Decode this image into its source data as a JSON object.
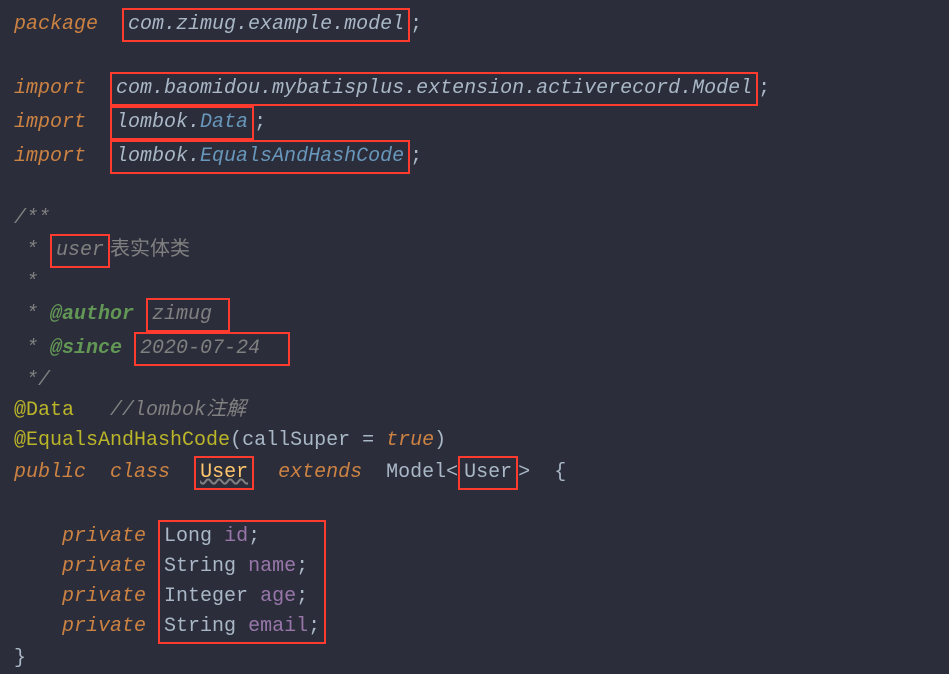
{
  "code": {
    "package_kw": "package",
    "package_name": "com.zimug.example.model",
    "import_kw": "import",
    "import1": "com.baomidou.mybatisplus.extension.activerecord.Model",
    "import2_pre": "lombok.",
    "import2_cls": "Data",
    "import3_pre": "lombok.",
    "import3_cls": "EqualsAndHashCode",
    "doc_start": "/**",
    "doc_user": "user",
    "doc_user_suffix": "表实体类",
    "doc_star": " *",
    "doc_author_tag": "@author",
    "doc_author_val": "zimug ",
    "doc_since_tag": "@since",
    "doc_since_val": "2020-07-24  ",
    "doc_end": " */",
    "anno_data": "@Data",
    "anno_data_comment": "//lombok注解",
    "anno_eq": "@EqualsAndHashCode",
    "anno_eq_param": "callSuper",
    "anno_eq_eq": " = ",
    "anno_eq_val": "true",
    "public_kw": "public",
    "class_kw": "class",
    "class_name": "User",
    "extends_kw": "extends",
    "model_name": "Model",
    "generic_user": "User",
    "private_kw": "private",
    "type_long": "Long",
    "field_id": "id",
    "type_string": "String",
    "field_name": "name",
    "type_integer": "Integer",
    "field_age": "age",
    "field_email": "email"
  }
}
